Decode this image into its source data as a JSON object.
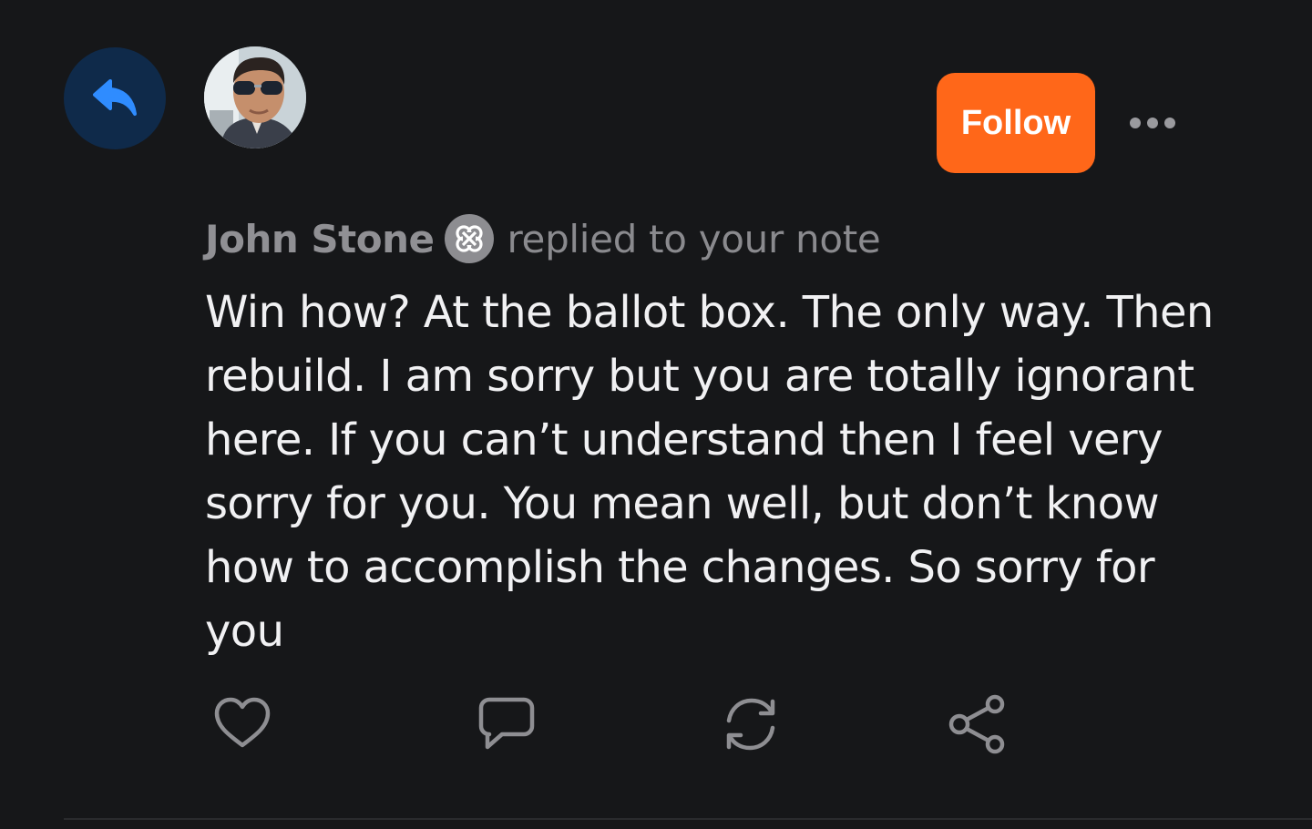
{
  "note": {
    "author": "John Stone",
    "action": "replied to your note",
    "body": "Win how? At the ballot box. The only way. Then rebuild. I am sorry but you are totally ignorant here. If you can’t understand then I feel very sorry for you. You mean well, but don’t know how to accomplish the changes. So sorry for you"
  },
  "follow_button": {
    "label": "Follow"
  },
  "colors": {
    "background": "#161719",
    "accent": "#ff6719",
    "reply_badge_bg": "#0f2a4a",
    "reply_icon": "#2f8cff",
    "muted_text": "#8a8a8e",
    "body_text": "#f1f1f3"
  },
  "icons": {
    "reply_badge": "reply-arrow-icon",
    "author_badge": "clover-badge-icon",
    "more": "ellipsis-icon",
    "actions": [
      "heart-icon",
      "comment-icon",
      "restack-icon",
      "share-icon"
    ]
  }
}
